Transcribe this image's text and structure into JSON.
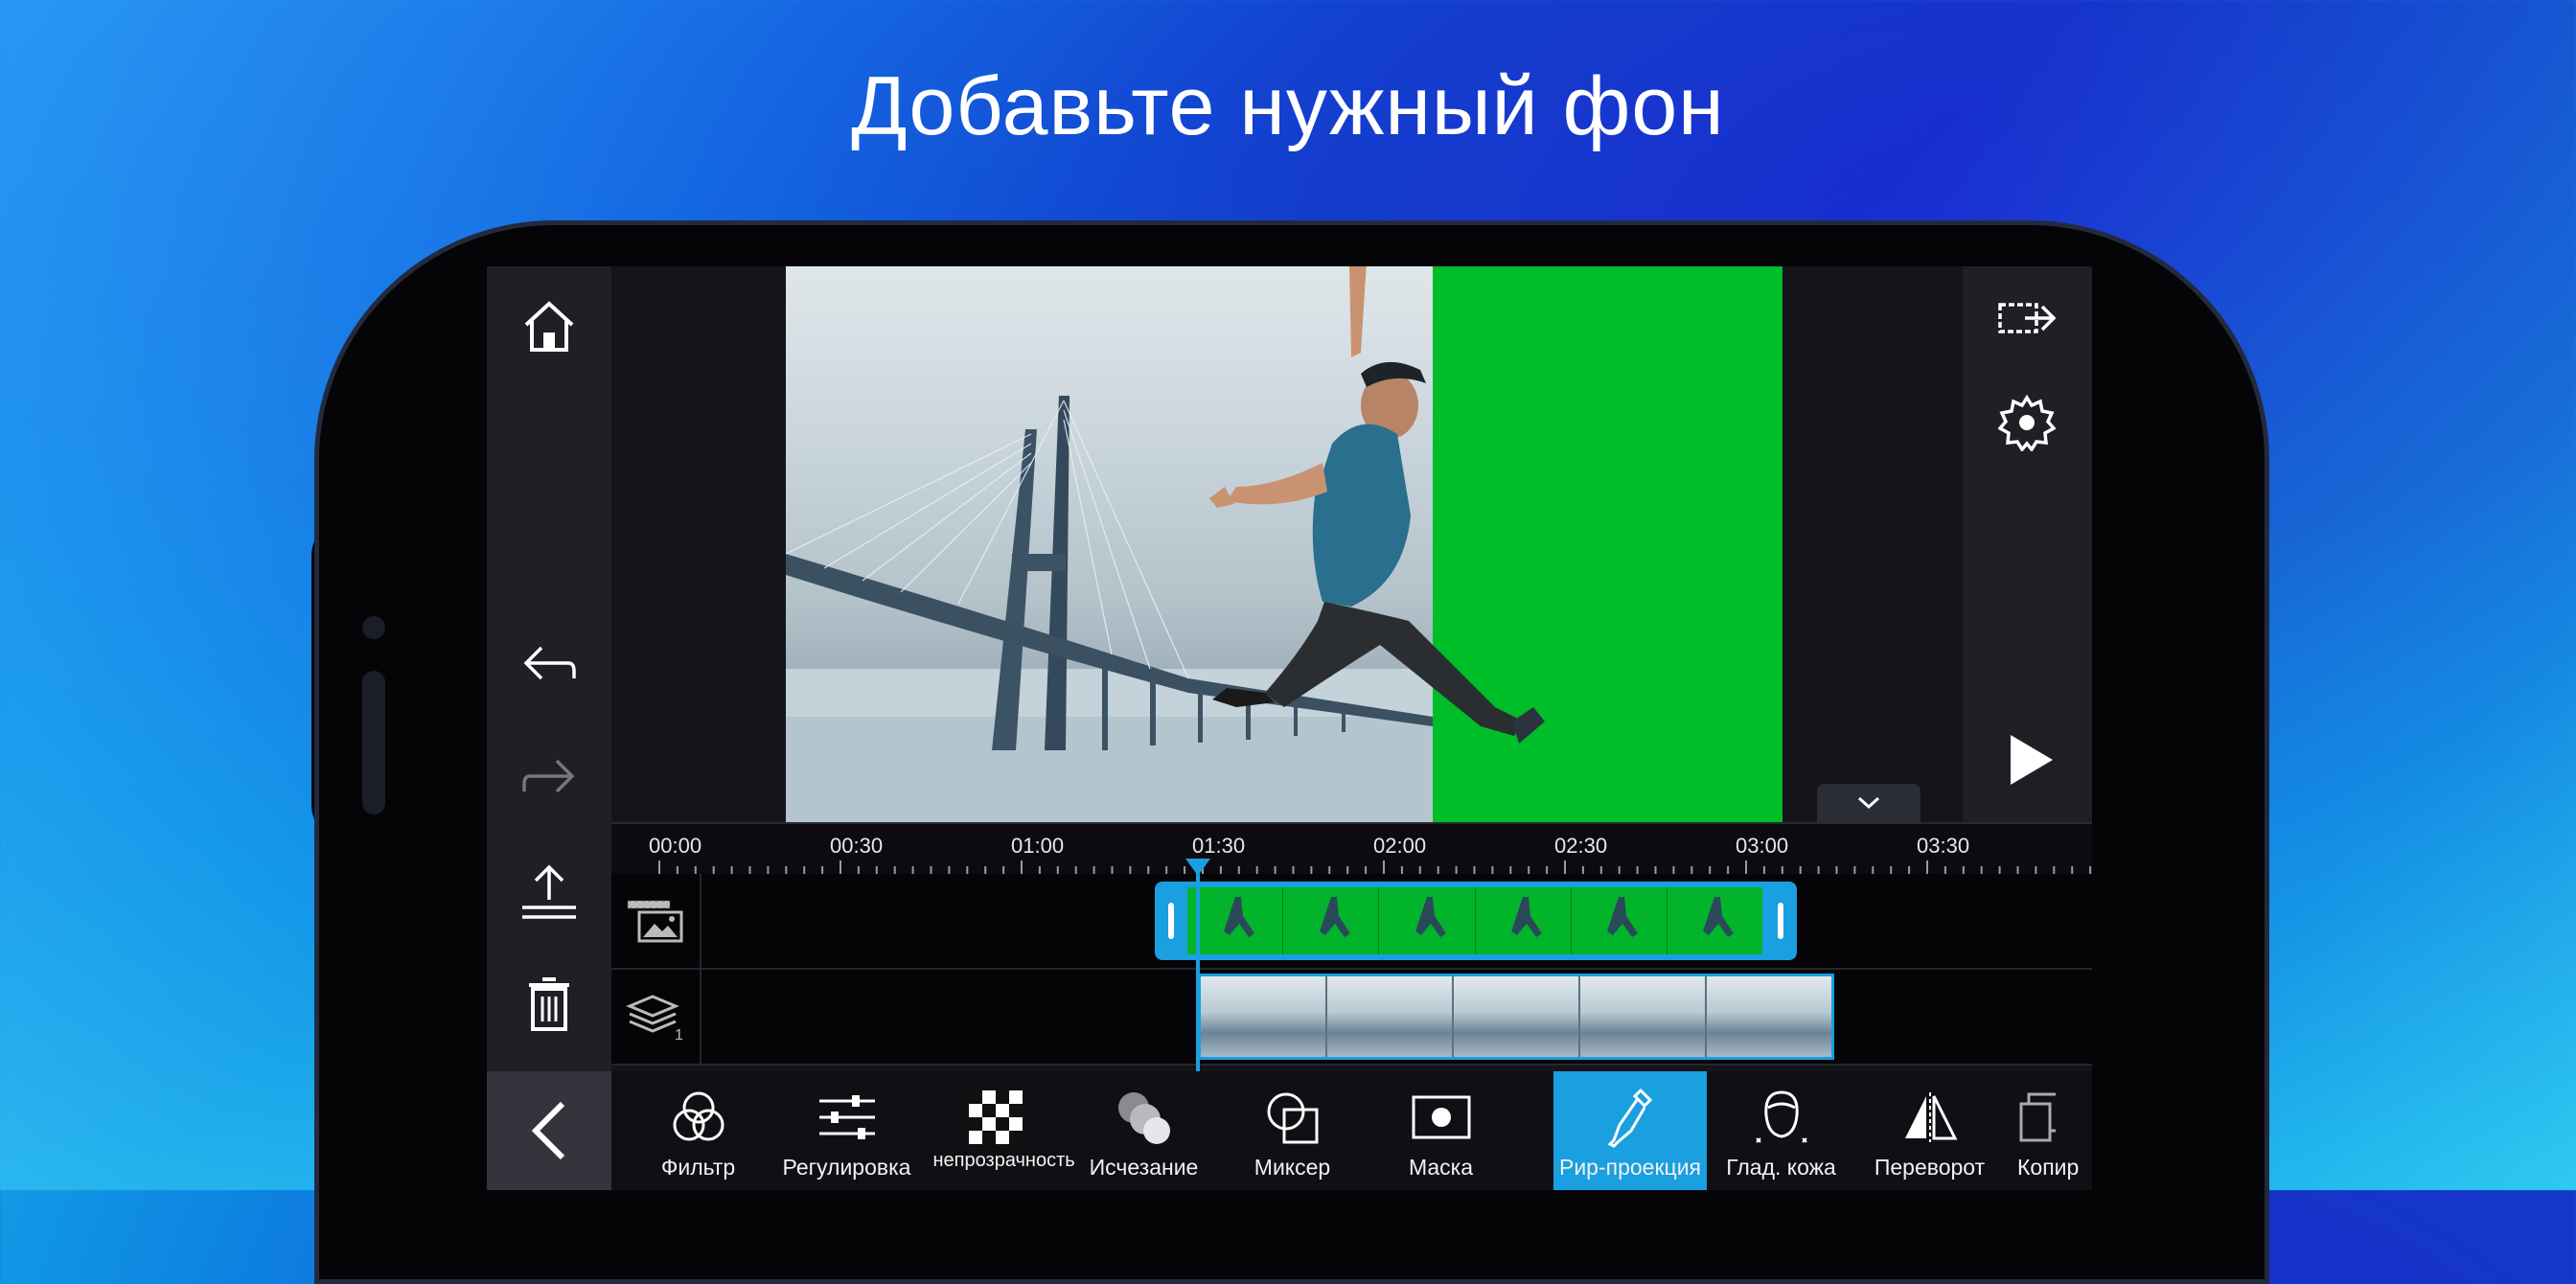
{
  "headline": "Добавьте нужный фон",
  "sidebar": {
    "icons": [
      "home-icon",
      "undo-icon",
      "redo-icon",
      "upload-icon",
      "trash-icon"
    ]
  },
  "right_sidebar": {
    "icons": [
      "export-icon",
      "settings-icon",
      "play-icon"
    ]
  },
  "timeline": {
    "ticks": [
      "00:00",
      "00:30",
      "01:00",
      "01:30",
      "02:00",
      "02:30",
      "03:00",
      "03:30"
    ],
    "layer_count": "1"
  },
  "toolbar": {
    "items": [
      {
        "label": "Фильтр",
        "icon": "filter-icon"
      },
      {
        "label": "Регулировка",
        "icon": "adjust-icon"
      },
      {
        "label": "непрозрачность",
        "icon": "opacity-icon"
      },
      {
        "label": "Исчезание",
        "icon": "fade-icon"
      },
      {
        "label": "Миксер",
        "icon": "blend-icon"
      },
      {
        "label": "Маска",
        "icon": "mask-icon"
      },
      {
        "label": "Рир-проекция",
        "icon": "chroma-key-icon"
      },
      {
        "label": "Глад. кожа",
        "icon": "skin-smooth-icon"
      },
      {
        "label": "Переворот",
        "icon": "flip-icon"
      },
      {
        "label": "Копир",
        "icon": "copy-icon"
      }
    ]
  },
  "colors": {
    "accent": "#1a9fe0",
    "green_screen": "#00bd2a"
  }
}
